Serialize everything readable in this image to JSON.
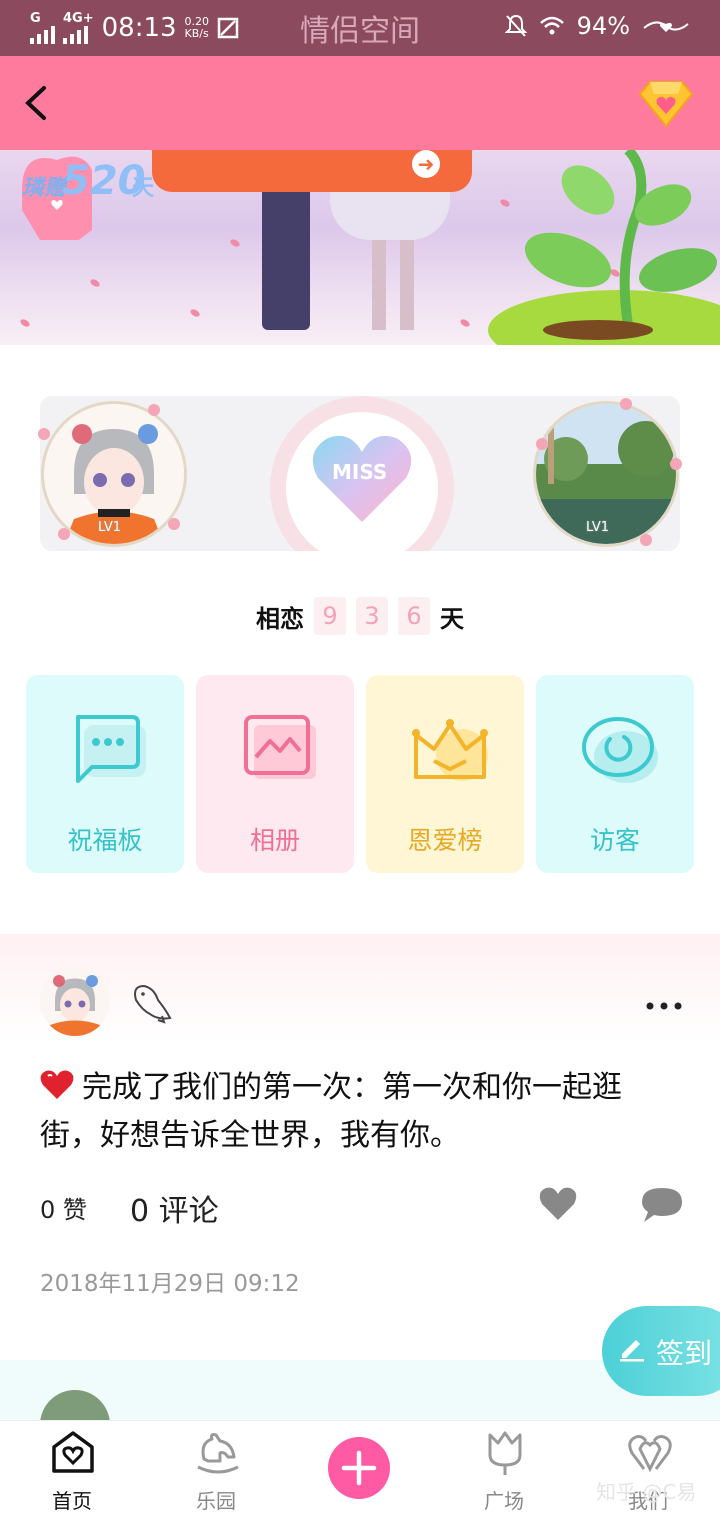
{
  "status_bar": {
    "network": "G",
    "network2": "4G+",
    "time": "08:13",
    "speed_value": "0.20",
    "speed_unit": "KB/s",
    "title": "情侣空间",
    "battery": "94%"
  },
  "banner": {
    "badge_text": "璘赠",
    "badge_number": "520",
    "badge_unit": "天"
  },
  "couple": {
    "left_level": "LV1",
    "right_level": "LV1",
    "center_label": "MISS",
    "together_label": "相恋",
    "days_digits": [
      "9",
      "3",
      "6"
    ],
    "days_unit": "天"
  },
  "features": [
    {
      "label": "祝福板",
      "icon": "chat-bubble-icon"
    },
    {
      "label": "相册",
      "icon": "photo-album-icon"
    },
    {
      "label": "恩爱榜",
      "icon": "crown-icon"
    },
    {
      "label": "访客",
      "icon": "visitor-ring-icon"
    }
  ],
  "post": {
    "text": "完成了我们的第一次：第一次和你一起逛街，好想告诉全世界，我有你。",
    "likes_count": "0",
    "likes_label": "赞",
    "comments_count": "0",
    "comments_label": "评论",
    "time": "2018年11月29日 09:12"
  },
  "signin_label": "签到",
  "bottom_nav": [
    {
      "label": "首页"
    },
    {
      "label": "乐园"
    },
    {
      "label": "广场"
    },
    {
      "label": "我们"
    }
  ],
  "watermark": "知乎 @C易",
  "colors": {
    "status_bar": "#8c4a5f",
    "header": "#ff7b9e",
    "add_button": "#ff5aa3",
    "signin": "#4cd0d6"
  }
}
